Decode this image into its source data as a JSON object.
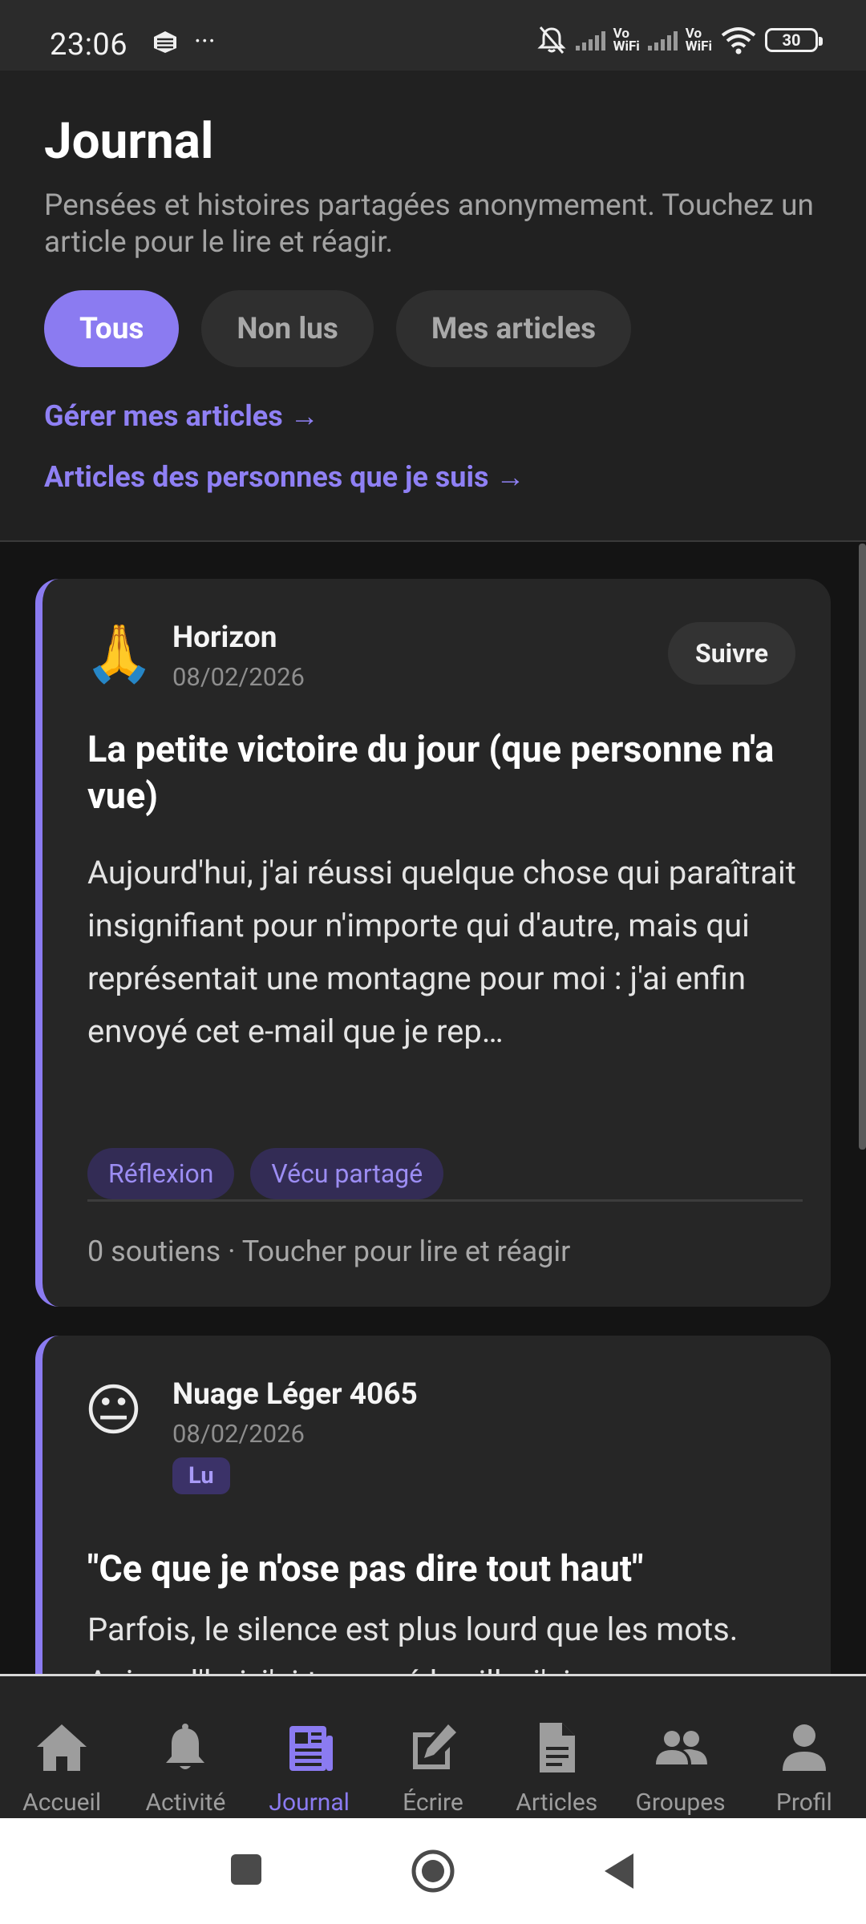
{
  "status_bar": {
    "time": "23:06",
    "more_dots": "···",
    "battery": "30",
    "vowifi_1": "Vo\nWiFi",
    "vowifi_2": "Vo\nWiFi"
  },
  "header": {
    "title": "Journal",
    "subtitle": "Pensées et histoires partagées anonymement. Touchez un article pour le lire et réagir.",
    "filters": [
      "Tous",
      "Non lus",
      "Mes articles"
    ],
    "active_filter": "Tous",
    "link_manage": "Gérer mes articles →",
    "link_following": "Articles des personnes que je suis →"
  },
  "feed": {
    "accent_color": "#8b7bf1",
    "cards": [
      {
        "avatar_emoji": "🙏",
        "author": "Horizon",
        "date": "08/02/2026",
        "follow_label": "Suivre",
        "title": "La petite victoire du jour (que personne n'a vue)",
        "excerpt": "Aujourd'hui, j'ai réussi quelque chose qui paraîtrait insignifiant pour n'importe qui d'autre, mais qui représentait une montagne pour moi : j'ai enfin envoyé cet e-mail que je rep…",
        "tags": [
          "Réflexion",
          "Vécu partagé"
        ],
        "footer": "0 soutiens · Toucher pour lire et réagir"
      },
      {
        "avatar_emoji": "😐",
        "author": "Nuage Léger 4065",
        "date": "08/02/2026",
        "badge": "Lu",
        "title": "\"Ce que je n'ose pas dire tout haut\"",
        "excerpt": "Parfois, le silence est plus lourd que les mots. Aujourd'hui, j'ai traversé la ville, j'ai"
      }
    ]
  },
  "bottom_nav": {
    "active": "Journal",
    "items": [
      {
        "label": "Accueil",
        "icon": "home-icon"
      },
      {
        "label": "Activité",
        "icon": "bell-icon"
      },
      {
        "label": "Journal",
        "icon": "newspaper-icon"
      },
      {
        "label": "Écrire",
        "icon": "edit-icon"
      },
      {
        "label": "Articles",
        "icon": "document-icon"
      },
      {
        "label": "Groupes",
        "icon": "group-icon"
      },
      {
        "label": "Profil",
        "icon": "person-icon"
      }
    ]
  }
}
